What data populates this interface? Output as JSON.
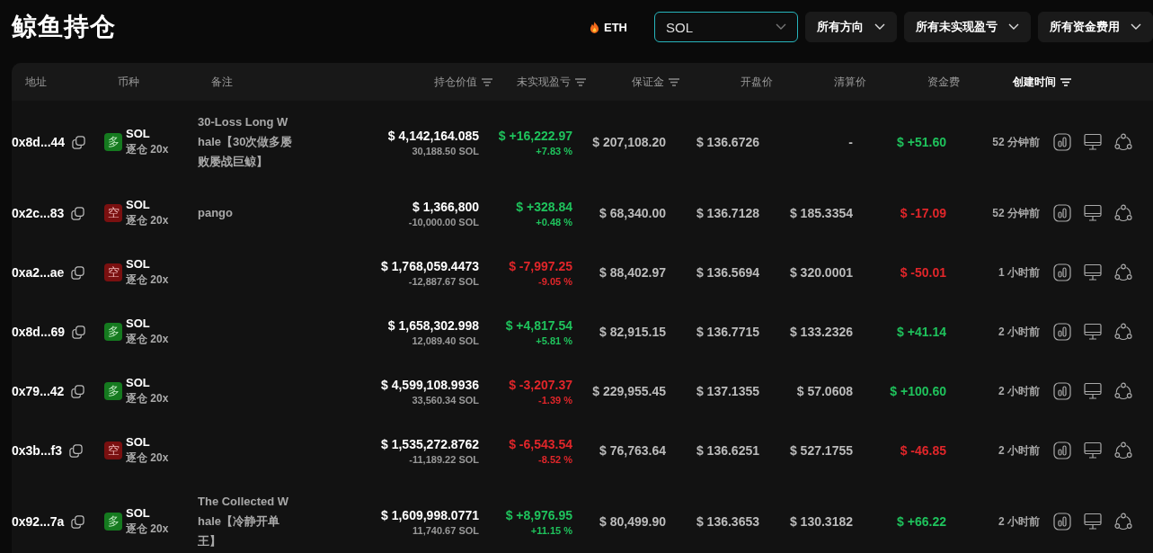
{
  "title": "鲸鱼持仓",
  "filters": {
    "eth_label": "ETH",
    "coin_select": {
      "value": "SOL",
      "focused": true
    },
    "selects": [
      {
        "label": "所有方向"
      },
      {
        "label": "所有未实现盈亏"
      },
      {
        "label": "所有资金费用"
      }
    ]
  },
  "table": {
    "columns": [
      {
        "label": "地址",
        "kind": "plain",
        "selected": false
      },
      {
        "label": "币种",
        "kind": "plain",
        "selected": false
      },
      {
        "label": "备注",
        "kind": "plain",
        "selected": false
      },
      {
        "label": "持仓价值",
        "kind": "sortable",
        "selected": false
      },
      {
        "label": "未实现盈亏",
        "kind": "sortable",
        "selected": false
      },
      {
        "label": "保证金",
        "kind": "sortable",
        "selected": false
      },
      {
        "label": "开盘价",
        "kind": "plain",
        "selected": false
      },
      {
        "label": "清算价",
        "kind": "plain",
        "selected": false
      },
      {
        "label": "资金费",
        "kind": "plain",
        "selected": false
      },
      {
        "label": "创建时间",
        "kind": "sortable",
        "selected": true
      }
    ],
    "rows": [
      {
        "address": "0x8d...44",
        "long": true,
        "side_label": "多",
        "coin": "SOL",
        "mode": "逐仓 20x",
        "note": "30-Loss Long Whale【30次做多屡败屡战巨鲸】",
        "value": "$ 4,142,164.085",
        "size": "30,188.50 SOL",
        "pnl": "$ +16,222.97",
        "pnl_pct": "+7.83 %",
        "pnl_up": true,
        "margin": "$ 207,108.20",
        "open": "$ 136.6726",
        "liq": "-",
        "funding": "$ +51.60",
        "funding_up": true,
        "time": "52 分钟前"
      },
      {
        "address": "0x2c...83",
        "long": false,
        "side_label": "空",
        "coin": "SOL",
        "mode": "逐仓 20x",
        "note": "pango",
        "value": "$ 1,366,800",
        "size": "-10,000.00 SOL",
        "pnl": "$ +328.84",
        "pnl_pct": "+0.48 %",
        "pnl_up": true,
        "margin": "$ 68,340.00",
        "open": "$ 136.7128",
        "liq": "$ 185.3354",
        "funding": "$ -17.09",
        "funding_up": false,
        "time": "52 分钟前"
      },
      {
        "address": "0xa2...ae",
        "long": false,
        "side_label": "空",
        "coin": "SOL",
        "mode": "逐仓 20x",
        "value": "$ 1,768,059.4473",
        "size": "-12,887.67 SOL",
        "pnl": "$ -7,997.25",
        "pnl_pct": "-9.05 %",
        "pnl_up": false,
        "margin": "$ 88,402.97",
        "open": "$ 136.5694",
        "liq": "$ 320.0001",
        "funding": "$ -50.01",
        "funding_up": false,
        "time": "1 小时前"
      },
      {
        "address": "0x8d...69",
        "long": true,
        "side_label": "多",
        "coin": "SOL",
        "mode": "逐仓 20x",
        "value": "$ 1,658,302.998",
        "size": "12,089.40 SOL",
        "pnl": "$ +4,817.54",
        "pnl_pct": "+5.81 %",
        "pnl_up": true,
        "margin": "$ 82,915.15",
        "open": "$ 136.7715",
        "liq": "$ 133.2326",
        "funding": "$ +41.14",
        "funding_up": true,
        "time": "2 小时前"
      },
      {
        "address": "0x79...42",
        "long": true,
        "side_label": "多",
        "coin": "SOL",
        "mode": "逐仓 20x",
        "value": "$ 4,599,108.9936",
        "size": "33,560.34 SOL",
        "pnl": "$ -3,207.37",
        "pnl_pct": "-1.39 %",
        "pnl_up": false,
        "margin": "$ 229,955.45",
        "open": "$ 137.1355",
        "liq": "$ 57.0608",
        "funding": "$ +100.60",
        "funding_up": true,
        "time": "2 小时前"
      },
      {
        "address": "0x3b...f3",
        "long": false,
        "side_label": "空",
        "coin": "SOL",
        "mode": "逐仓 20x",
        "value": "$ 1,535,272.8762",
        "size": "-11,189.22 SOL",
        "pnl": "$ -6,543.54",
        "pnl_pct": "-8.52 %",
        "pnl_up": false,
        "margin": "$ 76,763.64",
        "open": "$ 136.6251",
        "liq": "$ 527.1755",
        "funding": "$ -46.85",
        "funding_up": false,
        "time": "2 小时前"
      },
      {
        "address": "0x92...7a",
        "long": true,
        "side_label": "多",
        "coin": "SOL",
        "mode": "逐仓 20x",
        "note": "The Collected Whale【冷静开单王】",
        "value": "$ 1,609,998.0771",
        "size": "11,740.67 SOL",
        "pnl": "$ +8,976.95",
        "pnl_pct": "+11.15 %",
        "pnl_up": true,
        "margin": "$ 80,499.90",
        "open": "$ 136.3653",
        "liq": "$ 130.3182",
        "funding": "$ +66.22",
        "funding_up": true,
        "time": "2 小时前"
      }
    ]
  }
}
